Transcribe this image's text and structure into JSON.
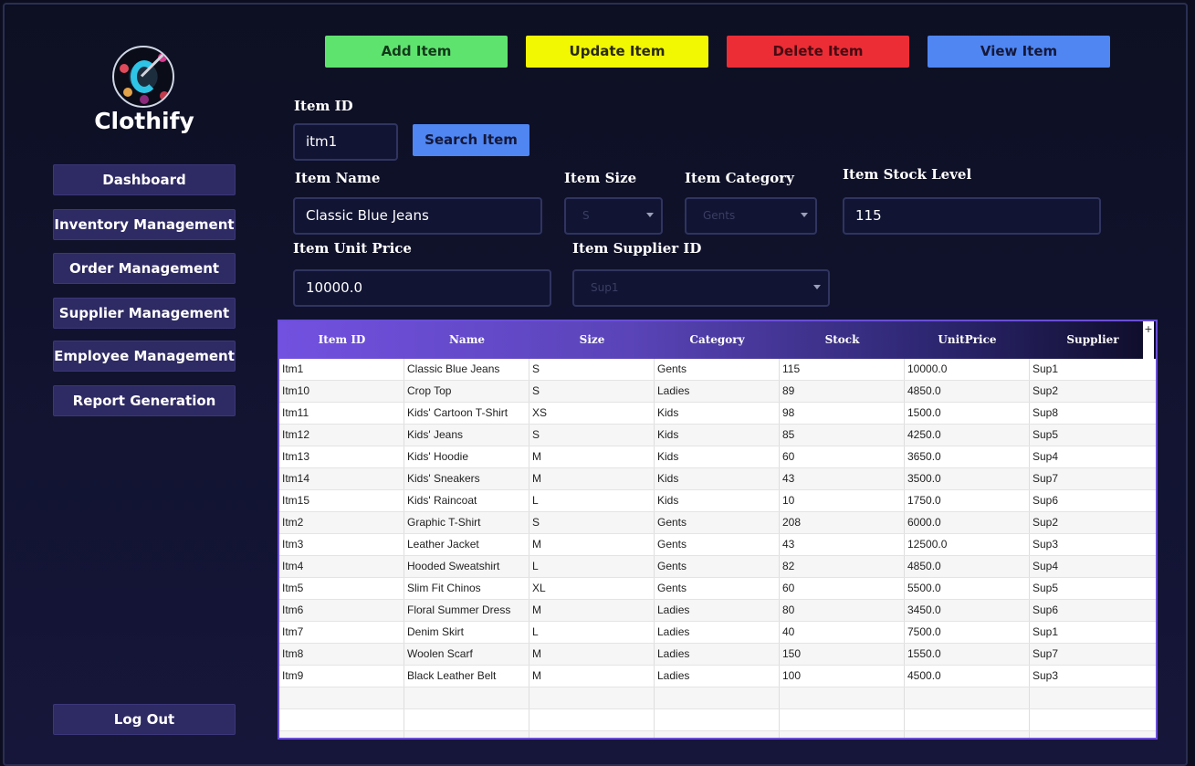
{
  "app": {
    "brand": "Clothify"
  },
  "sidebar": {
    "items": [
      {
        "label": "Dashboard"
      },
      {
        "label": "Inventory Management"
      },
      {
        "label": "Order Management"
      },
      {
        "label": "Supplier Management"
      },
      {
        "label": "Employee Management"
      },
      {
        "label": "Report Generation"
      }
    ],
    "logout_label": "Log Out"
  },
  "toolbar": {
    "add_label": "Add Item",
    "update_label": "Update Item",
    "delete_label": "Delete Item",
    "view_label": "View Item",
    "colors": {
      "add": "#5fe36f",
      "update": "#f2f702",
      "delete": "#ec2d36",
      "view": "#4f86f2"
    }
  },
  "form": {
    "item_id_label": "Item ID",
    "item_id_value": "itm1",
    "search_label": "Search Item",
    "item_name_label": "Item Name",
    "item_name_value": "Classic Blue Jeans",
    "item_size_label": "Item Size",
    "item_size_value": "S",
    "item_category_label": "Item Category",
    "item_category_value": "Gents",
    "item_stock_label": "Item Stock Level",
    "item_stock_value": "115",
    "item_price_label": "Item Unit Price",
    "item_price_value": "10000.0",
    "item_supplier_label": "Item Supplier ID",
    "item_supplier_value": "Sup1"
  },
  "table": {
    "columns": [
      "Item ID",
      "Name",
      "Size",
      "Category",
      "Stock",
      "UnitPrice",
      "Supplier"
    ],
    "add_column_symbol": "+",
    "rows": [
      [
        "Itm1",
        "Classic Blue Jeans",
        "S",
        "Gents",
        "115",
        "10000.0",
        "Sup1"
      ],
      [
        "Itm10",
        "Crop Top",
        "S",
        "Ladies",
        "89",
        "4850.0",
        "Sup2"
      ],
      [
        "Itm11",
        "Kids' Cartoon T-Shirt",
        "XS",
        "Kids",
        "98",
        "1500.0",
        "Sup8"
      ],
      [
        "Itm12",
        "Kids' Jeans",
        "S",
        "Kids",
        "85",
        "4250.0",
        "Sup5"
      ],
      [
        "Itm13",
        "Kids' Hoodie",
        "M",
        "Kids",
        "60",
        "3650.0",
        "Sup4"
      ],
      [
        "Itm14",
        "Kids' Sneakers",
        "M",
        "Kids",
        "43",
        "3500.0",
        "Sup7"
      ],
      [
        "Itm15",
        "Kids' Raincoat",
        "L",
        "Kids",
        "10",
        "1750.0",
        "Sup6"
      ],
      [
        "Itm2",
        "Graphic T-Shirt",
        "S",
        "Gents",
        "208",
        "6000.0",
        "Sup2"
      ],
      [
        "Itm3",
        "Leather Jacket",
        "M",
        "Gents",
        "43",
        "12500.0",
        "Sup3"
      ],
      [
        "Itm4",
        "Hooded Sweatshirt",
        "L",
        "Gents",
        "82",
        "4850.0",
        "Sup4"
      ],
      [
        "Itm5",
        "Slim Fit Chinos",
        "XL",
        "Gents",
        "60",
        "5500.0",
        "Sup5"
      ],
      [
        "Itm6",
        "Floral Summer Dress",
        "M",
        "Ladies",
        "80",
        "3450.0",
        "Sup6"
      ],
      [
        "Itm7",
        "Denim Skirt",
        "L",
        "Ladies",
        "40",
        "7500.0",
        "Sup1"
      ],
      [
        "Itm8",
        "Woolen Scarf",
        "M",
        "Ladies",
        "150",
        "1550.0",
        "Sup7"
      ],
      [
        "Itm9",
        "Black Leather Belt",
        "M",
        "Ladies",
        "100",
        "4500.0",
        "Sup3"
      ]
    ],
    "empty_rows": 3
  }
}
